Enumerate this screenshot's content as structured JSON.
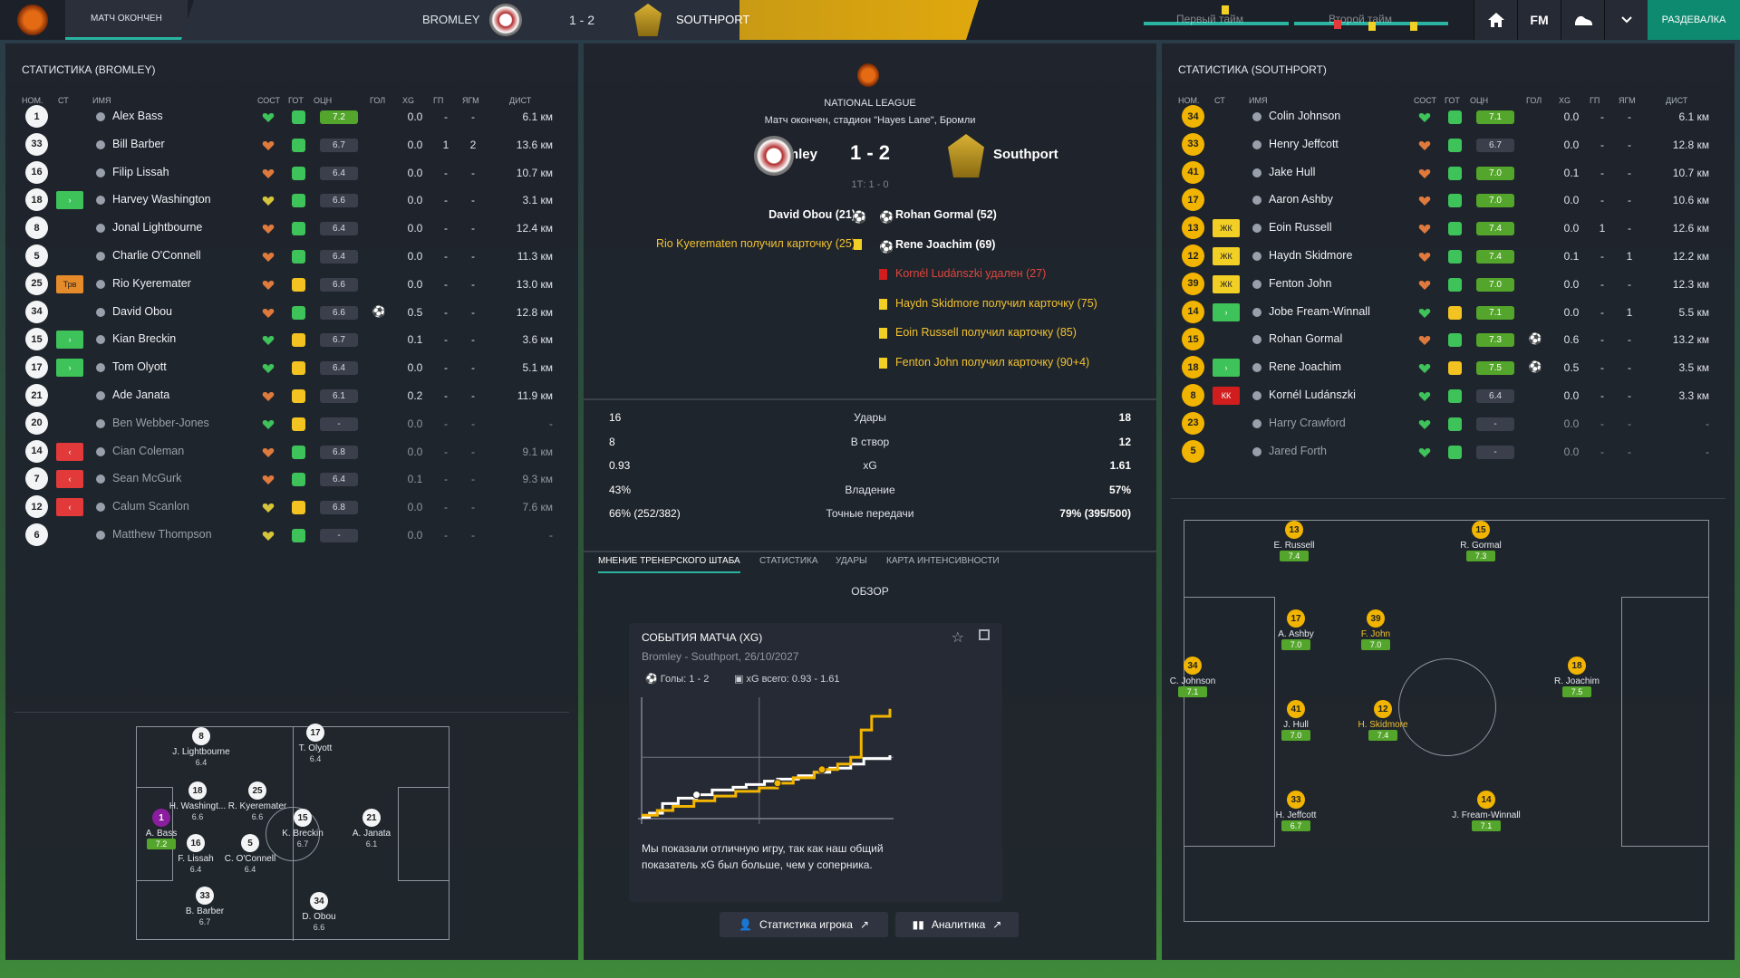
{
  "topbar": {
    "tab": "МАТЧ ОКОНЧЕН",
    "home": "BROMLEY",
    "away": "SOUTHPORT",
    "score": "1 - 2",
    "first_half": "Первый тайм",
    "second_half": "Второй тайм",
    "fm": "FM",
    "lockers": "РАЗДЕВАЛКА"
  },
  "left": {
    "title": "СТАТИСТИКА (BROMLEY)",
    "cols": [
      "НОМ.",
      "СТ",
      "ИМЯ",
      "СОСТ",
      "ГОТ",
      "ОЦН",
      "ГОЛ",
      "XG",
      "ГП",
      "ЯГМ",
      "ДИСТ"
    ],
    "rows": [
      {
        "no": "1",
        "st": "",
        "name": "Alex Bass",
        "cond": "g",
        "ready": "g",
        "rt": "7.2",
        "rg": true,
        "goal": "",
        "xg": "0.0",
        "gp": "-",
        "ygm": "-",
        "dist": "6.1 км",
        "dim": false
      },
      {
        "no": "33",
        "st": "",
        "name": "Bill Barber",
        "cond": "o",
        "ready": "g",
        "rt": "6.7",
        "rg": false,
        "goal": "",
        "xg": "0.0",
        "gp": "1",
        "ygm": "2",
        "dist": "13.6 км",
        "dim": false
      },
      {
        "no": "16",
        "st": "",
        "name": "Filip Lissah",
        "cond": "o",
        "ready": "g",
        "rt": "6.4",
        "rg": false,
        "goal": "",
        "xg": "0.0",
        "gp": "-",
        "ygm": "-",
        "dist": "10.7 км",
        "dim": false
      },
      {
        "no": "18",
        "st": "in",
        "name": "Harvey Washington",
        "cond": "y",
        "ready": "g",
        "rt": "6.6",
        "rg": false,
        "goal": "",
        "xg": "0.0",
        "gp": "-",
        "ygm": "-",
        "dist": "3.1 км",
        "dim": false
      },
      {
        "no": "8",
        "st": "",
        "name": "Jonal Lightbourne",
        "cond": "o",
        "ready": "g",
        "rt": "6.4",
        "rg": false,
        "goal": "",
        "xg": "0.0",
        "gp": "-",
        "ygm": "-",
        "dist": "12.4 км",
        "dim": false
      },
      {
        "no": "5",
        "st": "",
        "name": "Charlie O'Connell",
        "cond": "o",
        "ready": "g",
        "rt": "6.4",
        "rg": false,
        "goal": "",
        "xg": "0.0",
        "gp": "-",
        "ygm": "-",
        "dist": "11.3 км",
        "dim": false
      },
      {
        "no": "25",
        "st": "tr",
        "name": "Rio Kyeremater",
        "cond": "o",
        "ready": "m",
        "rt": "6.6",
        "rg": false,
        "goal": "",
        "xg": "0.0",
        "gp": "-",
        "ygm": "-",
        "dist": "13.0 км",
        "dim": false
      },
      {
        "no": "34",
        "st": "",
        "name": "David Obou",
        "cond": "o",
        "ready": "g",
        "rt": "6.6",
        "rg": false,
        "goal": "⚽",
        "xg": "0.5",
        "gp": "-",
        "ygm": "-",
        "dist": "12.8 км",
        "dim": false
      },
      {
        "no": "15",
        "st": "in",
        "name": "Kian Breckin",
        "cond": "g",
        "ready": "m",
        "rt": "6.7",
        "rg": false,
        "goal": "",
        "xg": "0.1",
        "gp": "-",
        "ygm": "-",
        "dist": "3.6 км",
        "dim": false
      },
      {
        "no": "17",
        "st": "in",
        "name": "Tom Olyott",
        "cond": "g",
        "ready": "m",
        "rt": "6.4",
        "rg": false,
        "goal": "",
        "xg": "0.0",
        "gp": "-",
        "ygm": "-",
        "dist": "5.1 км",
        "dim": false
      },
      {
        "no": "21",
        "st": "",
        "name": "Ade Janata",
        "cond": "o",
        "ready": "m",
        "rt": "6.1",
        "rg": false,
        "goal": "",
        "xg": "0.2",
        "gp": "-",
        "ygm": "-",
        "dist": "11.9 км",
        "dim": false
      },
      {
        "no": "20",
        "st": "",
        "name": "Ben Webber-Jones",
        "cond": "g",
        "ready": "m",
        "rt": "-",
        "rg": false,
        "goal": "",
        "xg": "0.0",
        "gp": "-",
        "ygm": "-",
        "dist": "-",
        "dim": true
      },
      {
        "no": "14",
        "st": "out",
        "name": "Cian Coleman",
        "cond": "o",
        "ready": "g",
        "rt": "6.8",
        "rg": false,
        "goal": "",
        "xg": "0.0",
        "gp": "-",
        "ygm": "-",
        "dist": "9.1 км",
        "dim": true
      },
      {
        "no": "7",
        "st": "out",
        "name": "Sean McGurk",
        "cond": "o",
        "ready": "g",
        "rt": "6.4",
        "rg": false,
        "goal": "",
        "xg": "0.1",
        "gp": "-",
        "ygm": "-",
        "dist": "9.3 км",
        "dim": true
      },
      {
        "no": "12",
        "st": "out",
        "name": "Calum Scanlon",
        "cond": "y",
        "ready": "m",
        "rt": "6.8",
        "rg": false,
        "goal": "",
        "xg": "0.0",
        "gp": "-",
        "ygm": "-",
        "dist": "7.6 км",
        "dim": true
      },
      {
        "no": "6",
        "st": "",
        "name": "Matthew Thompson",
        "cond": "y",
        "ready": "g",
        "rt": "-",
        "rg": false,
        "goal": "",
        "xg": "0.0",
        "gp": "-",
        "ygm": "-",
        "dist": "-",
        "dim": true
      }
    ],
    "pitch": [
      {
        "no": "8",
        "name": "J. Lightbourne",
        "rt": "6.4"
      },
      {
        "no": "17",
        "name": "T. Olyott",
        "rt": "6.4"
      },
      {
        "no": "18",
        "name": "H. Washingt...",
        "rt": "6.6"
      },
      {
        "no": "25",
        "name": "R. Kyeremater",
        "rt": "6.6"
      },
      {
        "no": "1",
        "name": "A. Bass",
        "rt": "7.2"
      },
      {
        "no": "16",
        "name": "F. Lissah",
        "rt": "6.4"
      },
      {
        "no": "5",
        "name": "C. O'Connell",
        "rt": "6.4"
      },
      {
        "no": "15",
        "name": "K. Breckin",
        "rt": "6.7"
      },
      {
        "no": "21",
        "name": "A. Janata",
        "rt": "6.1"
      },
      {
        "no": "33",
        "name": "B. Barber",
        "rt": "6.7"
      },
      {
        "no": "34",
        "name": "D. Obou",
        "rt": "6.6"
      }
    ]
  },
  "center": {
    "league": "NATIONAL LEAGUE",
    "info": "Матч окончен, стадион \"Hayes Lane\", Бромли",
    "home": "Bromley",
    "away": "Southport",
    "score": "1 - 2",
    "ht": "1Т: 1 - 0",
    "home_events": [
      "David Obou (21)",
      "Rio Kyerematen получил карточку (25)"
    ],
    "away_events": [
      "Rohan Gormal (52)",
      "Rene Joachim (69)",
      "Kornél Ludánszki удален (27)",
      "Haydn Skidmore получил карточку (75)",
      "Eoin Russell получил карточку (85)",
      "Fenton John получил карточку (90+4)"
    ],
    "stats": [
      {
        "h": "16",
        "l": "Удары",
        "a": "18"
      },
      {
        "h": "8",
        "l": "В створ",
        "a": "12"
      },
      {
        "h": "0.93",
        "l": "xG",
        "a": "1.61"
      },
      {
        "h": "43%",
        "l": "Владение",
        "a": "57%"
      },
      {
        "h": "66% (252/382)",
        "l": "Точные передачи",
        "a": "79% (395/500)"
      }
    ],
    "tabs": [
      "МНЕНИЕ ТРЕНЕРСКОГО ШТАБА",
      "СТАТИСТИКА",
      "УДАРЫ",
      "КАРТА ИНТЕНСИВНОСТИ"
    ],
    "overview": "ОБЗОР",
    "card": {
      "title": "СОБЫТИЯ МАТЧА (XG)",
      "sub": "Bromley - Southport, 26/10/2027",
      "goals": "Голы: 1 - 2",
      "xg": "xG всего: 0.93 - 1.61",
      "text": "Мы показали отличную игру, так как наш общий показатель xG был больше, чем у соперника."
    },
    "btn1": "Статистика игрока",
    "btn2": "Аналитика",
    "colors": {
      "home": "#ffffff",
      "away": "#f1b400"
    }
  },
  "chart_data": {
    "type": "line",
    "title": "СОБЫТИЯ МАТЧА (XG)",
    "xlim": [
      0,
      95
    ],
    "ylim": [
      0,
      1.7
    ],
    "series": [
      {
        "name": "Bromley",
        "color": "#ffffff",
        "x": [
          0,
          3,
          8,
          14,
          21,
          21,
          27,
          35,
          40,
          47,
          52,
          60,
          66,
          72,
          80,
          85,
          95
        ],
        "y": [
          0.02,
          0.08,
          0.22,
          0.3,
          0.35,
          0.35,
          0.42,
          0.46,
          0.5,
          0.55,
          0.58,
          0.63,
          0.68,
          0.74,
          0.8,
          0.88,
          0.93
        ]
      },
      {
        "name": "Southport",
        "color": "#f1b400",
        "x": [
          0,
          6,
          12,
          20,
          28,
          36,
          45,
          52,
          58,
          66,
          69,
          75,
          80,
          84,
          88,
          95
        ],
        "y": [
          0.05,
          0.12,
          0.18,
          0.26,
          0.33,
          0.4,
          0.45,
          0.52,
          0.6,
          0.68,
          0.72,
          0.8,
          0.9,
          1.3,
          1.5,
          1.61
        ]
      }
    ]
  },
  "right": {
    "title": "СТАТИСТИКА (SOUTHPORT)",
    "cols": [
      "НОМ.",
      "СТ",
      "ИМЯ",
      "СОСТ",
      "ГОТ",
      "ОЦН",
      "ГОЛ",
      "XG",
      "ГП",
      "ЯГМ",
      "ДИСТ"
    ],
    "rows": [
      {
        "no": "34",
        "st": "",
        "name": "Colin Johnson",
        "cond": "g",
        "ready": "g",
        "rt": "7.1",
        "rg": true,
        "goal": "",
        "xg": "0.0",
        "gp": "-",
        "ygm": "-",
        "dist": "6.1 км",
        "dim": false
      },
      {
        "no": "33",
        "st": "",
        "name": "Henry Jeffcott",
        "cond": "o",
        "ready": "g",
        "rt": "6.7",
        "rg": false,
        "goal": "",
        "xg": "0.0",
        "gp": "-",
        "ygm": "-",
        "dist": "12.8 км",
        "dim": false
      },
      {
        "no": "41",
        "st": "",
        "name": "Jake Hull",
        "cond": "o",
        "ready": "g",
        "rt": "7.0",
        "rg": true,
        "goal": "",
        "xg": "0.1",
        "gp": "-",
        "ygm": "-",
        "dist": "10.7 км",
        "dim": false
      },
      {
        "no": "17",
        "st": "",
        "name": "Aaron Ashby",
        "cond": "o",
        "ready": "g",
        "rt": "7.0",
        "rg": true,
        "goal": "",
        "xg": "0.0",
        "gp": "-",
        "ygm": "-",
        "dist": "10.6 км",
        "dim": false
      },
      {
        "no": "13",
        "st": "yc",
        "name": "Eoin Russell",
        "cond": "o",
        "ready": "g",
        "rt": "7.4",
        "rg": true,
        "goal": "",
        "xg": "0.0",
        "gp": "1",
        "ygm": "-",
        "dist": "12.6 км",
        "dim": false
      },
      {
        "no": "12",
        "st": "yc",
        "name": "Haydn Skidmore",
        "cond": "o",
        "ready": "g",
        "rt": "7.4",
        "rg": true,
        "goal": "",
        "xg": "0.1",
        "gp": "-",
        "ygm": "1",
        "dist": "12.2 км",
        "dim": false
      },
      {
        "no": "39",
        "st": "yc",
        "name": "Fenton John",
        "cond": "o",
        "ready": "g",
        "rt": "7.0",
        "rg": true,
        "goal": "",
        "xg": "0.0",
        "gp": "-",
        "ygm": "-",
        "dist": "12.3 км",
        "dim": false
      },
      {
        "no": "14",
        "st": "in",
        "name": "Jobe Fream-Winnall",
        "cond": "g",
        "ready": "m",
        "rt": "7.1",
        "rg": true,
        "goal": "",
        "xg": "0.0",
        "gp": "-",
        "ygm": "1",
        "dist": "5.5 км",
        "dim": false
      },
      {
        "no": "15",
        "st": "",
        "name": "Rohan Gormal",
        "cond": "o",
        "ready": "g",
        "rt": "7.3",
        "rg": true,
        "goal": "⚽",
        "xg": "0.6",
        "gp": "-",
        "ygm": "-",
        "dist": "13.2 км",
        "dim": false
      },
      {
        "no": "18",
        "st": "in",
        "name": "Rene Joachim",
        "cond": "g",
        "ready": "m",
        "rt": "7.5",
        "rg": true,
        "goal": "⚽",
        "xg": "0.5",
        "gp": "-",
        "ygm": "-",
        "dist": "3.5 км",
        "dim": false
      },
      {
        "no": "8",
        "st": "rc",
        "name": "Kornél Ludánszki",
        "cond": "g",
        "ready": "g",
        "rt": "6.4",
        "rg": false,
        "goal": "",
        "xg": "0.0",
        "gp": "-",
        "ygm": "-",
        "dist": "3.3 км",
        "dim": false
      },
      {
        "no": "23",
        "st": "",
        "name": "Harry Crawford",
        "cond": "g",
        "ready": "g",
        "rt": "-",
        "rg": false,
        "goal": "",
        "xg": "0.0",
        "gp": "-",
        "ygm": "-",
        "dist": "-",
        "dim": true
      },
      {
        "no": "5",
        "st": "",
        "name": "Jared Forth",
        "cond": "g",
        "ready": "g",
        "rt": "-",
        "rg": false,
        "goal": "",
        "xg": "0.0",
        "gp": "-",
        "ygm": "-",
        "dist": "-",
        "dim": true
      }
    ],
    "st_labels": {
      "tr": "Трв",
      "yc": "ЖК",
      "rc": "КК"
    },
    "pitch": [
      {
        "no": "13",
        "name": "E. Russell",
        "rt": "7.4"
      },
      {
        "no": "15",
        "name": "R. Gormal",
        "rt": "7.3"
      },
      {
        "no": "17",
        "name": "A. Ashby",
        "rt": "7.0"
      },
      {
        "no": "39",
        "name": "F. John",
        "rt": "7.0"
      },
      {
        "no": "34",
        "name": "C. Johnson",
        "rt": "7.1"
      },
      {
        "no": "18",
        "name": "R. Joachim",
        "rt": "7.5"
      },
      {
        "no": "41",
        "name": "J. Hull",
        "rt": "7.0"
      },
      {
        "no": "12",
        "name": "H. Skidmore",
        "rt": "7.4"
      },
      {
        "no": "33",
        "name": "H. Jeffcott",
        "rt": "6.7"
      },
      {
        "no": "14",
        "name": "J. Fream-Winnall",
        "rt": "7.1"
      }
    ]
  }
}
